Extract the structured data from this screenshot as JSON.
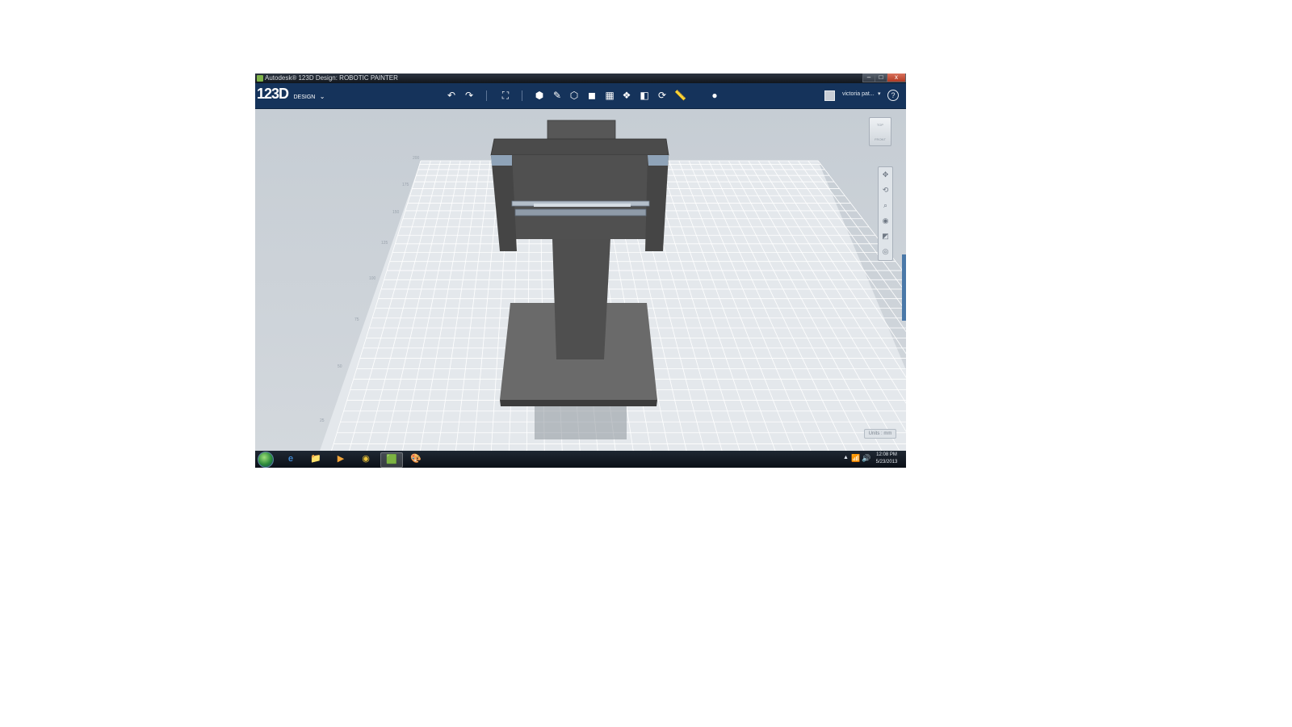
{
  "window": {
    "title": "Autodesk® 123D Design: ROBOTIC PAINTER",
    "min_label": "–",
    "max_label": "□",
    "close_label": "x"
  },
  "app": {
    "logo_number": "123D",
    "logo_sub": "DESIGN",
    "logo_chevron": "⌄",
    "user_name": "victoria pat...",
    "user_chevron": "▾",
    "help_label": "?"
  },
  "toolbar": {
    "undo": "↶",
    "redo": "↷",
    "transform": "⛶",
    "primitives": "⬢",
    "sketch": "✎",
    "construct": "⬡",
    "modify": "◼",
    "pattern": "▦",
    "grouping": "❖",
    "combine": "◧",
    "snap": "⟳",
    "measure": "📏",
    "material": "●"
  },
  "viewcube": {
    "top_label": "TOP",
    "front_label": "FRONT"
  },
  "grid_labels": [
    "200",
    "175",
    "150",
    "125",
    "100",
    "75",
    "50",
    "25"
  ],
  "units_label": "Units : mm",
  "taskbar": {
    "apps": [
      "e",
      "📁",
      "▶",
      "◉",
      "🟩",
      "🎨"
    ],
    "tray_up": "▲",
    "tray_net": "📶",
    "tray_vol": "🔊",
    "time": "12:08 PM",
    "date": "5/23/2013"
  },
  "colors": {
    "appbar": "#15335b",
    "model_dark": "#4a4a4a",
    "model_mid": "#5d5d5d",
    "model_light": "#6e6e6e",
    "accent_blue": "#4a78a8"
  }
}
